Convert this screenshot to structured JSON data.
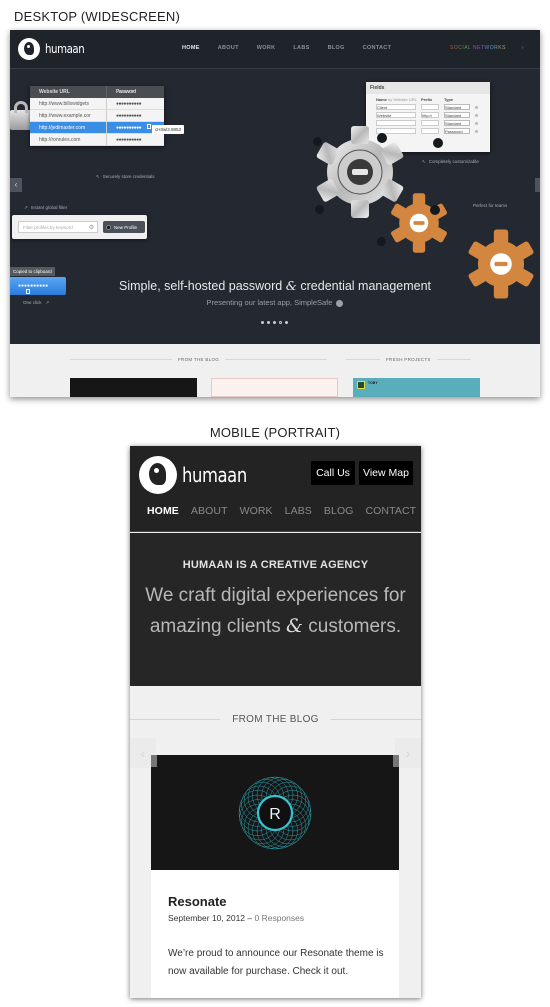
{
  "captions": {
    "desktop": "DESKTOP (WIDESCREEN)",
    "mobile": "MOBILE (PORTRAIT)"
  },
  "brand": {
    "name": "humaan"
  },
  "desktop": {
    "nav": [
      {
        "label": "HOME",
        "active": true
      },
      {
        "label": "ABOUT",
        "active": false
      },
      {
        "label": "WORK",
        "active": false
      },
      {
        "label": "LABS",
        "active": false
      },
      {
        "label": "BLOG",
        "active": false
      },
      {
        "label": "CONTACT",
        "active": false
      }
    ],
    "social_text": "SOCIAL NETWORKS",
    "social_arrow": "›",
    "credentials_table": {
      "headers": [
        "Website URL",
        "Password"
      ],
      "rows": [
        {
          "url": "http://www.billswidgets",
          "password": "●●●●●●●●●●",
          "selected": false
        },
        {
          "url": "http://www.example.cor",
          "password": "●●●●●●●●●●",
          "selected": false
        },
        {
          "url": "http://jedimaster.com",
          "password": "●●●●●●●●●●",
          "selected": true
        },
        {
          "url": "http://ronrules.com",
          "password": "●●●●●●●●●●",
          "selected": false
        }
      ],
      "revealed_password": "cH3wl3.9853"
    },
    "notes": {
      "securely": "Securely store credentials",
      "instant_filter": "Instant global filter",
      "one_click": "One click",
      "customizable": "Completely customizable",
      "teams": "Perfect for teams"
    },
    "filter": {
      "placeholder": "Filter profiles by keyword",
      "new_profile": "New Profile"
    },
    "copied_tooltip": "Copied to clipboard",
    "copied_password": "●●●●●●●●●●",
    "fields_panel": {
      "title": "Fields",
      "headers": [
        "Name",
        "by Website URL",
        "Prefix",
        "Type"
      ],
      "rows": [
        {
          "name": "Client",
          "prefix": "",
          "type": "Standard"
        },
        {
          "name": "Website",
          "prefix": "http://",
          "type": "Standard"
        },
        {
          "name": "",
          "prefix": "",
          "type": "Standard"
        },
        {
          "name": "",
          "prefix": "",
          "type": "Password"
        }
      ]
    },
    "hero": {
      "title_pre": "Simple, self-hosted password",
      "amp": "&",
      "title_post": "credential management",
      "subtitle": "Presenting our latest app, SimpleSafe",
      "slides_total": 5,
      "slide_active": 4
    },
    "side_arrows": {
      "left": "‹",
      "right": "›"
    },
    "sections": {
      "blog": "FROM THE BLOG",
      "projects": "FRESH PROJECTS"
    },
    "project_thumb_label": "TOBY"
  },
  "mobile": {
    "buttons": {
      "call": "Call Us",
      "map": "View Map"
    },
    "nav": [
      {
        "label": "HOME",
        "active": true
      },
      {
        "label": "ABOUT",
        "active": false
      },
      {
        "label": "WORK",
        "active": false
      },
      {
        "label": "LABS",
        "active": false
      },
      {
        "label": "BLOG",
        "active": false
      },
      {
        "label": "CONTACT",
        "active": false
      }
    ],
    "hero": {
      "tagline": "HUMAAN IS A CREATIVE AGENCY",
      "line1": "We craft digital experiences for",
      "line2_pre": "amazing clients",
      "amp": "&",
      "line2_post": "customers."
    },
    "blog_heading": "FROM THE BLOG",
    "arrows": {
      "left": "‹",
      "right": "›"
    },
    "post": {
      "image_letter": "R",
      "title": "Resonate",
      "date": "September 10, 2012",
      "separator": "–",
      "responses": "0 Responses",
      "excerpt": "We’re proud to announce our Resonate theme is now available for purchase. Check it out."
    }
  },
  "colors": {
    "desktop_bg": "#242830",
    "mobile_header": "#232323",
    "selected_row": "#3b8ee6",
    "gear_orange": "#d3863f",
    "resonate_teal": "#2fb3c0"
  }
}
